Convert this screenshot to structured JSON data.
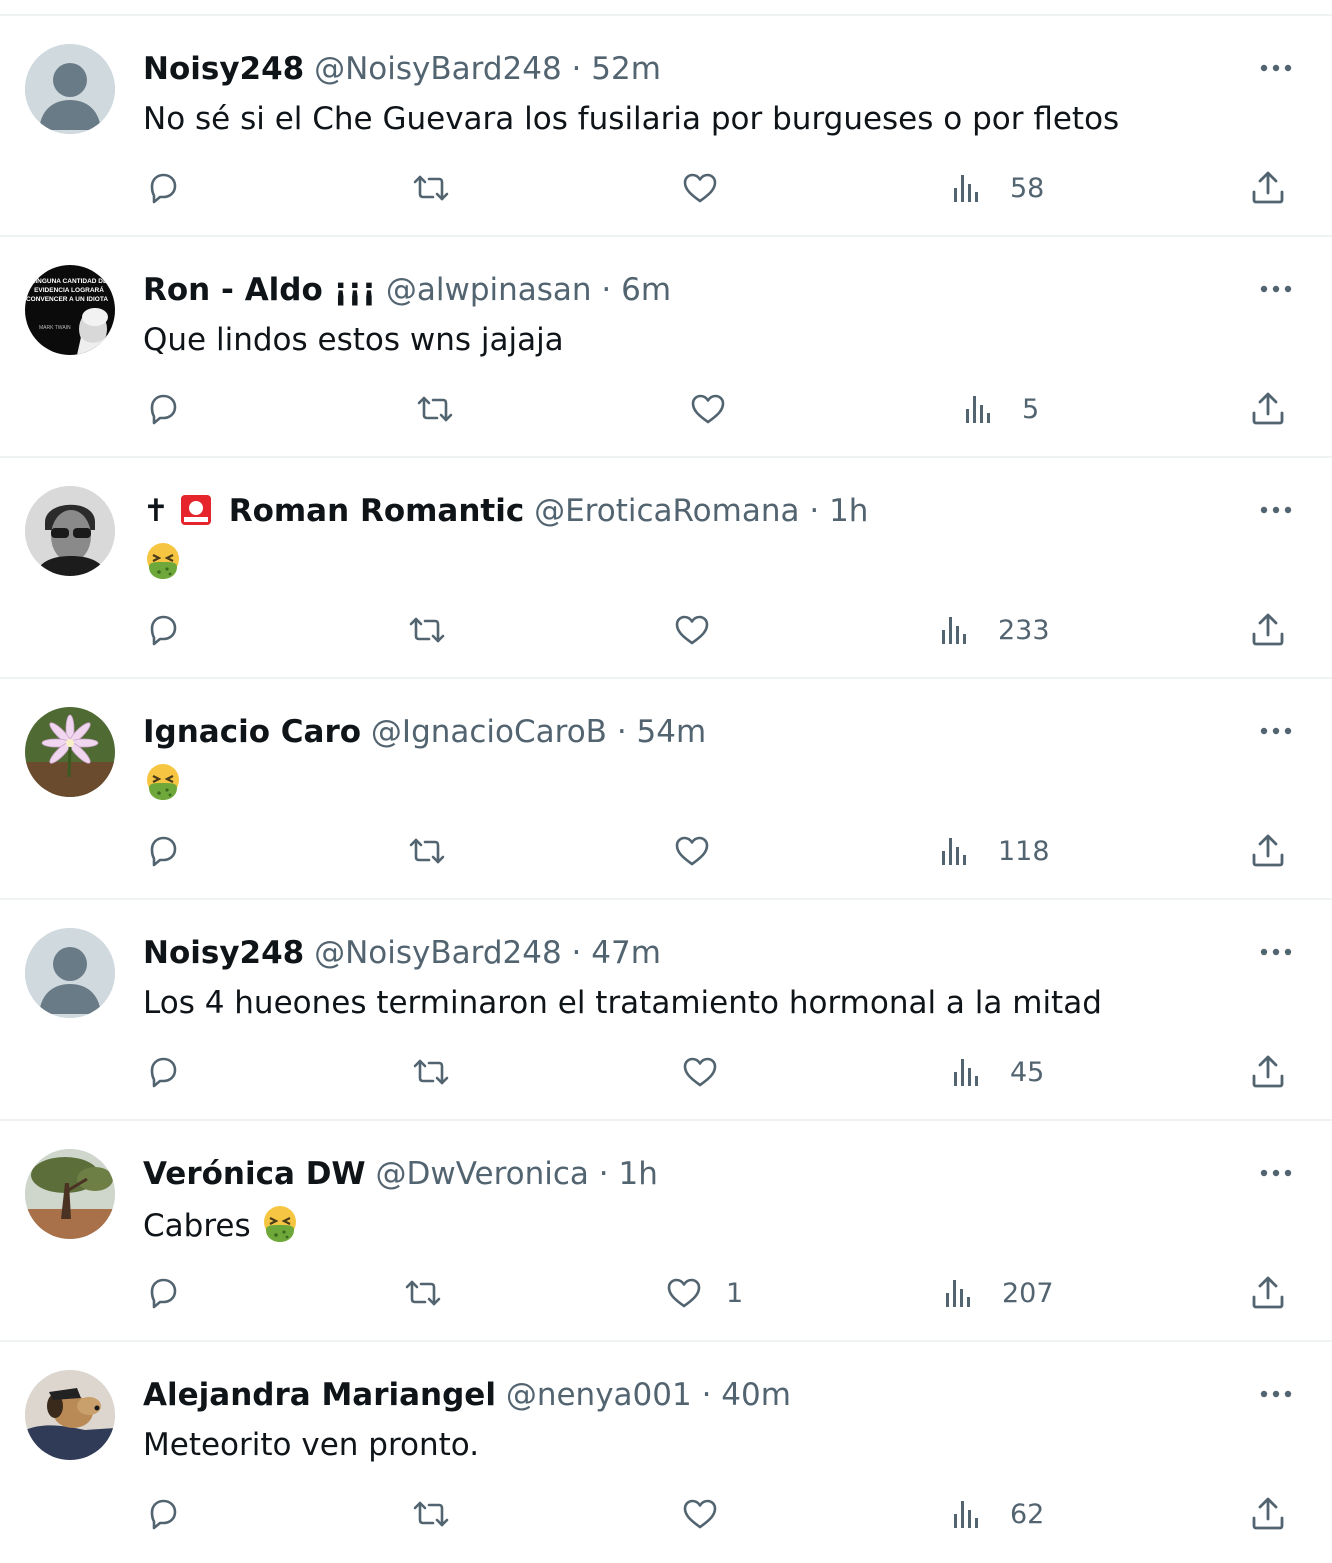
{
  "tweets": [
    {
      "name": "Noisy248",
      "handle": "@NoisyBard248",
      "separator": "·",
      "time": "52m",
      "text": "No sé si el Che Guevara los fusilaria por burgueses o por fletos",
      "likes": "",
      "views": "58",
      "avatar": "default-avatar"
    },
    {
      "name": "Ron - Aldo ¡¡¡",
      "handle": "@alwpinasan",
      "separator": "·",
      "time": "6m",
      "text": "Que lindos estos wns jajaja",
      "likes": "",
      "views": "5",
      "avatar": "quote-portrait-avatar",
      "avatar_text": [
        "NINGUNA CANTIDAD DE",
        "EVIDENCIA LOGRARÁ",
        "CONVENCER A UN IDIOTA",
        "MARK TWAIN"
      ]
    },
    {
      "name": "Roman Romantic",
      "name_prefix": "✝",
      "handle": "@EroticaRomana",
      "separator": "·",
      "time": "1h",
      "text": "",
      "likes": "",
      "views": "233",
      "avatar": "sunglasses-portrait-avatar"
    },
    {
      "name": "Ignacio Caro",
      "handle": "@IgnacioCaroB",
      "separator": "·",
      "time": "54m",
      "text": "",
      "likes": "",
      "views": "118",
      "avatar": "flower-photo-avatar"
    },
    {
      "name": "Noisy248",
      "handle": "@NoisyBard248",
      "separator": "·",
      "time": "47m",
      "text": "Los 4 hueones terminaron el tratamiento hormonal a la mitad",
      "likes": "",
      "views": "45",
      "avatar": "default-avatar"
    },
    {
      "name": "Verónica DW",
      "handle": "@DwVeronica",
      "separator": "·",
      "time": "1h",
      "text": "Cabres",
      "likes": "1",
      "views": "207",
      "avatar": "tree-photo-avatar"
    },
    {
      "name": "Alejandra Mariangel",
      "handle": "@nenya001",
      "separator": "·",
      "time": "40m",
      "text": "Meteorito ven pronto.",
      "likes": "",
      "views": "62",
      "avatar": "dog-photo-avatar"
    }
  ],
  "icons": {
    "reply": "reply-icon",
    "retweet": "retweet-icon",
    "like": "heart-icon",
    "views": "views-icon",
    "share": "share-icon",
    "more": "more-icon",
    "emoji": "nauseated-face-emoji",
    "badge": "red-square-emoji"
  },
  "colors": {
    "text_primary": "#0f1419",
    "text_secondary": "#536471",
    "divider": "#eff3f4",
    "avatar_default": "#cfd9de",
    "emoji_green": "#6fa83a"
  }
}
